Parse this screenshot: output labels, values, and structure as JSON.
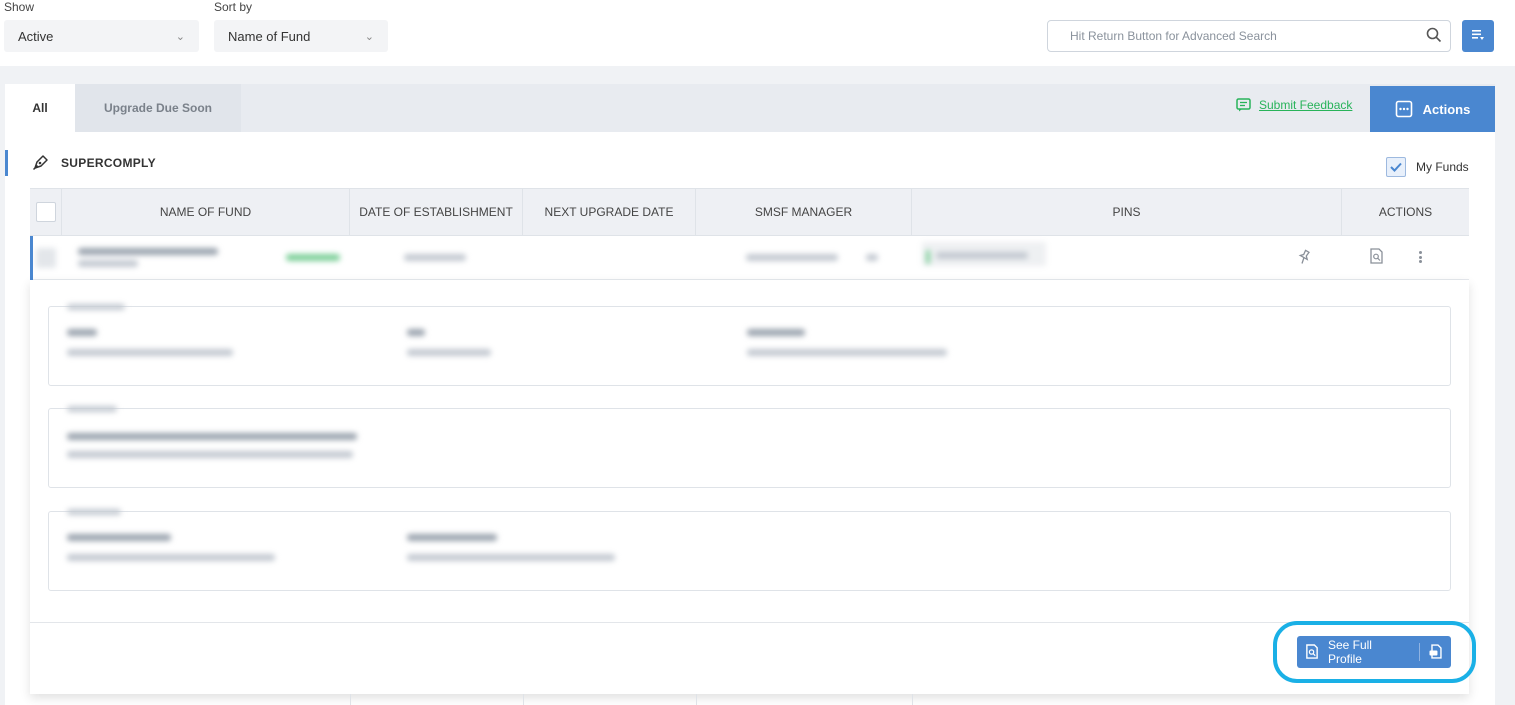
{
  "filters": {
    "show_label": "Show",
    "show_value": "Active",
    "sort_label": "Sort by",
    "sort_value": "Name of Fund"
  },
  "search": {
    "placeholder": "Hit Return Button for Advanced Search"
  },
  "tabs": [
    {
      "label": "All",
      "active": true
    },
    {
      "label": "Upgrade Due Soon",
      "active": false
    }
  ],
  "toolbar": {
    "feedback_label": "Submit Feedback",
    "actions_label": "Actions"
  },
  "section": {
    "title": "SUPERCOMPLY",
    "my_funds_label": "My Funds",
    "my_funds_checked": true
  },
  "table": {
    "columns": [
      "NAME OF FUND",
      "DATE OF ESTABLISHMENT",
      "NEXT UPGRADE DATE",
      "SMSF MANAGER",
      "PINS",
      "ACTIONS"
    ]
  },
  "expanded": {
    "profile_button_label": "See Full Profile"
  },
  "colors": {
    "accent": "#4a87d0",
    "feedback": "#28b35a",
    "highlight": "#1ab0e6"
  }
}
